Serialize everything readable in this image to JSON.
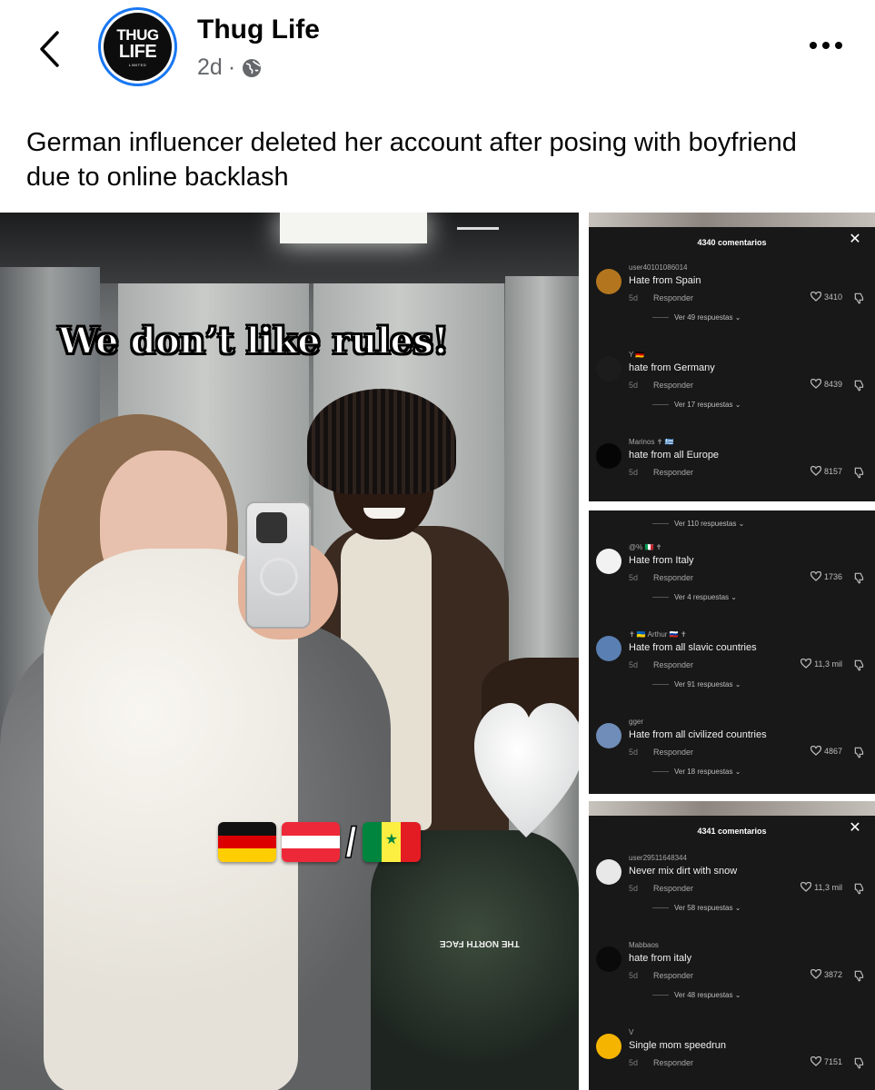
{
  "header": {
    "back_icon": "chevron-left-icon",
    "avatar": {
      "line1": "THUG",
      "line2": "LIFE",
      "line3": "LIMITED"
    },
    "page_name": "Thug Life",
    "time": "2d",
    "separator": "·",
    "privacy_icon": "globe-icon",
    "more_icon": "more-horizontal-icon"
  },
  "post": {
    "caption": "German influencer deleted her account after posing with boyfriend due to online backlash",
    "overlay_text": "We don’t like rules!",
    "flags_separator": "/",
    "jacket_logo": "THE NORTH FACE"
  },
  "panels": [
    {
      "header": "4340 comentarios",
      "comments": [
        {
          "user": "user40101086014",
          "text": "Hate from Spain",
          "time": "5d",
          "reply": "Responder",
          "likes": "3410",
          "more": "Ver 49 respuestas ⌄",
          "avatar_color": "#b3761f"
        },
        {
          "user": "Y 🇩🇪",
          "text": "hate from Germany",
          "time": "5d",
          "reply": "Responder",
          "likes": "8439",
          "more": "Ver 17 respuestas ⌄",
          "avatar_color": "#1c1c1c"
        },
        {
          "user": "Marinos ✝ 🇬🇷",
          "text": "hate from all Europe",
          "time": "5d",
          "reply": "Responder",
          "likes": "8157",
          "more": "",
          "avatar_color": "#050505"
        }
      ]
    },
    {
      "top_more": "Ver 110 respuestas ⌄",
      "comments": [
        {
          "user": "@% 🇮🇹 ✝",
          "text": "Hate from Italy",
          "time": "5d",
          "reply": "Responder",
          "likes": "1736",
          "more": "Ver 4 respuestas ⌄",
          "avatar_color": "#f2f2f2"
        },
        {
          "user": "✝ 🇺🇦 Arthur 🇷🇺 ✝",
          "text": "Hate from all slavic countries",
          "time": "5d",
          "reply": "Responder",
          "likes": "11,3 mil",
          "more": "Ver 91 respuestas ⌄",
          "avatar_color": "#5a7fb3"
        },
        {
          "user": "gger",
          "text": "Hate from all civilized countries",
          "time": "5d",
          "reply": "Responder",
          "likes": "4867",
          "more": "Ver 18 respuestas ⌄",
          "avatar_color": "#6f8db8"
        }
      ]
    },
    {
      "header": "4341 comentarios",
      "comments": [
        {
          "user": "user29511648344",
          "text": "Never mix dirt with snow",
          "time": "5d",
          "reply": "Responder",
          "likes": "11,3 mil",
          "more": "Ver 58 respuestas ⌄",
          "avatar_color": "#e8e8e8"
        },
        {
          "user": "Mabbaos",
          "text": "hate from italy",
          "time": "5d",
          "reply": "Responder",
          "likes": "3872",
          "more": "Ver 48 respuestas ⌄",
          "avatar_color": "#0a0a0a"
        },
        {
          "user": "V",
          "text": "Single mom speedrun",
          "time": "5d",
          "reply": "Responder",
          "likes": "7151",
          "more": "",
          "avatar_color": "#f4b400"
        }
      ]
    }
  ],
  "close_glyph": "✕"
}
